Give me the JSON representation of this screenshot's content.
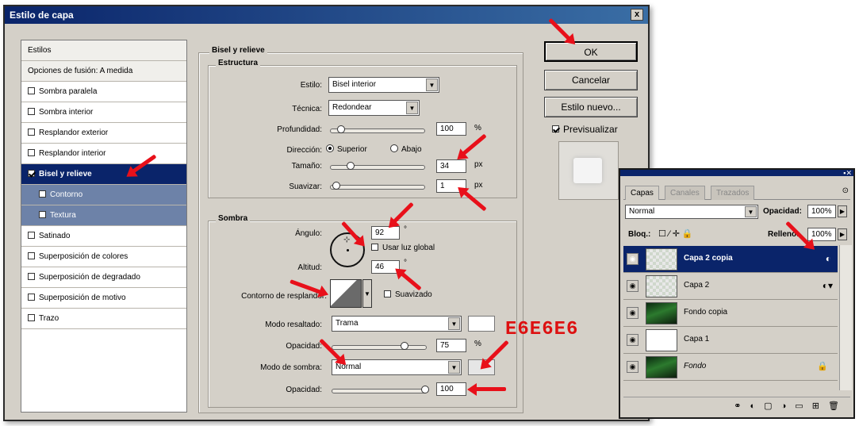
{
  "dialog": {
    "title": "Estilo de capa",
    "close": "x"
  },
  "styles_list": {
    "header": "Estilos",
    "blend_options": "Opciones de fusión: A medida",
    "items": [
      {
        "label": "Sombra paralela",
        "checked": false
      },
      {
        "label": "Sombra interior",
        "checked": false
      },
      {
        "label": "Resplandor exterior",
        "checked": false
      },
      {
        "label": "Resplandor interior",
        "checked": false
      },
      {
        "label": "Bisel y relieve",
        "checked": true,
        "selected": true
      },
      {
        "label": "Contorno",
        "checked": false,
        "sub": true
      },
      {
        "label": "Textura",
        "checked": false,
        "sub": true
      },
      {
        "label": "Satinado",
        "checked": false
      },
      {
        "label": "Superposición de colores",
        "checked": false
      },
      {
        "label": "Superposición de degradado",
        "checked": false
      },
      {
        "label": "Superposición de motivo",
        "checked": false
      },
      {
        "label": "Trazo",
        "checked": false
      }
    ]
  },
  "bevel": {
    "section_title": "Bisel y relieve",
    "structure_title": "Estructura",
    "style_label": "Estilo:",
    "style_value": "Bisel interior",
    "technique_label": "Técnica:",
    "technique_value": "Redondear",
    "depth_label": "Profundidad:",
    "depth_value": "100",
    "depth_unit": "%",
    "direction_label": "Dirección:",
    "direction_up": "Superior",
    "direction_down": "Abajo",
    "size_label": "Tamaño:",
    "size_value": "34",
    "size_unit": "px",
    "soften_label": "Suavizar:",
    "soften_value": "1",
    "soften_unit": "px"
  },
  "shading": {
    "title": "Sombra",
    "angle_label": "Ángulo:",
    "angle_value": "92",
    "angle_unit": "°",
    "global_light": "Usar luz global",
    "altitude_label": "Altitud:",
    "altitude_value": "46",
    "altitude_unit": "°",
    "gloss_label": "Contorno de resplandor:",
    "antialias": "Suavizado",
    "highlight_mode_label": "Modo resaltado:",
    "highlight_mode_value": "Trama",
    "highlight_opacity_label": "Opacidad:",
    "highlight_opacity_value": "75",
    "highlight_opacity_unit": "%",
    "shadow_mode_label": "Modo de sombra:",
    "shadow_mode_value": "Normal",
    "shadow_opacity_label": "Opacidad:",
    "shadow_opacity_value": "100",
    "highlight_color": "#ffffff",
    "shadow_color": "#e6e6e6"
  },
  "annotation": {
    "hex": "E6E6E6"
  },
  "buttons": {
    "ok": "OK",
    "cancel": "Cancelar",
    "new_style": "Estilo nuevo...",
    "preview": "Previsualizar"
  },
  "layers": {
    "tabs": [
      "Capas",
      "Canales",
      "Trazados"
    ],
    "blend_mode": "Normal",
    "opacity_label": "Opacidad:",
    "opacity_value": "100%",
    "lock_label": "Bloq.:",
    "fill_label": "Relleno:",
    "fill_value": "100%",
    "rows": [
      {
        "name": "Capa 2 copia",
        "active": true
      },
      {
        "name": "Capa 2",
        "active": false
      },
      {
        "name": "Fondo copia",
        "active": false
      },
      {
        "name": "Capa 1",
        "active": false
      },
      {
        "name": "Fondo",
        "active": false
      }
    ]
  },
  "colors": {
    "title_bar": "#0a246a",
    "dialog_bg": "#d4d0c8",
    "annotation_red": "#e8101a"
  }
}
